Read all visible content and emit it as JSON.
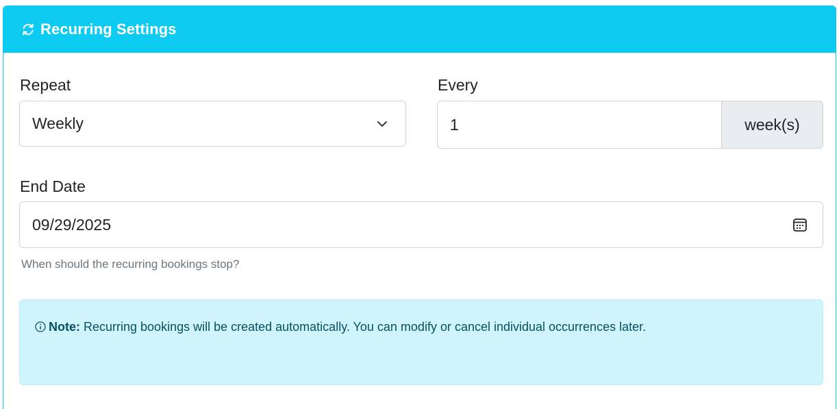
{
  "header": {
    "title": "Recurring Settings",
    "icon": "refresh-icon"
  },
  "repeat": {
    "label": "Repeat",
    "selected": "Weekly",
    "icon": "chevron-down-icon"
  },
  "every": {
    "label": "Every",
    "value": "1",
    "unit": "week(s)"
  },
  "end_date": {
    "label": "End Date",
    "value": "09/29/2025",
    "icon": "calendar-icon",
    "help": "When should the recurring bookings stop?"
  },
  "note": {
    "icon": "info-icon",
    "label": "Note:",
    "text": " Recurring bookings will be created automatically. You can modify or cancel individual occurrences later."
  },
  "colors": {
    "accent": "#0dcaf0",
    "alert_bg": "#cff4fc",
    "alert_text": "#055160"
  }
}
